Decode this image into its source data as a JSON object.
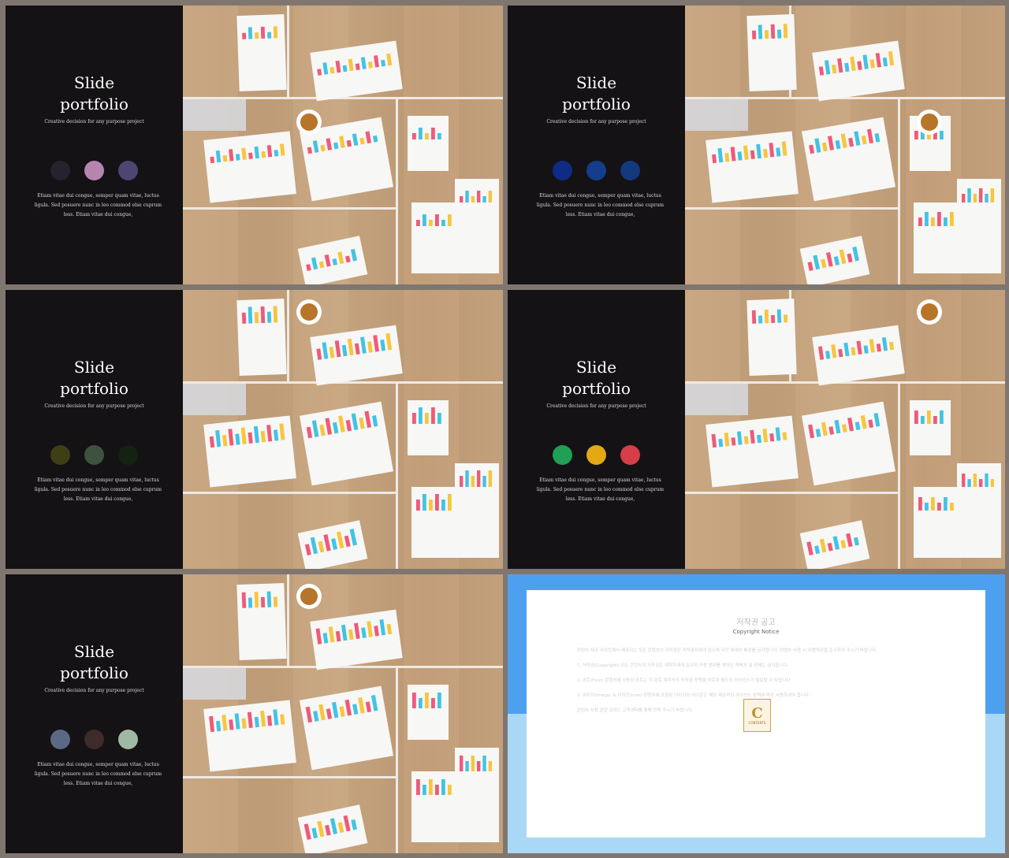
{
  "slides": [
    {
      "title": "Slide\nportfolio",
      "subtitle": "Creative decision for any purpose  project",
      "swatches": [
        "#26232f",
        "#b784b0",
        "#4d4572"
      ],
      "body": "Etiam vitae dui congue, semper  quam vitae, luctus ligula. Sed posuere nunc in leo commod else cuprum less. Etiam vitae dui congue,"
    },
    {
      "title": "Slide\nportfolio",
      "subtitle": "Creative decision for any purpose  project",
      "swatches": [
        "#0d2b87",
        "#143d8e",
        "#123a7c"
      ],
      "body": "Etiam vitae dui congue, semper  quam vitae, luctus ligula. Sed posuere nunc in leo commod else cuprum less. Etiam vitae dui congue,"
    },
    {
      "title": "Slide\nportfolio",
      "subtitle": "Creative decision for any purpose  project",
      "swatches": [
        "#3f3f16",
        "#3e523d",
        "#12230f"
      ],
      "body": "Etiam vitae dui congue, semper  quam vitae, luctus ligula. Sed posuere nunc in leo commod else cuprum less. Etiam vitae dui congue,"
    },
    {
      "title": "Slide\nportfolio",
      "subtitle": "Creative decision for any purpose  project",
      "swatches": [
        "#1fa055",
        "#e4a815",
        "#d63e4a"
      ],
      "body": "Etiam vitae dui congue, semper  quam vitae, luctus ligula. Sed posuere nunc in leo commod else cuprum less. Etiam vitae dui congue,"
    },
    {
      "title": "Slide\nportfolio",
      "subtitle": "Creative decision for any purpose  project",
      "swatches": [
        "#5a6a85",
        "#3e2b2a",
        "#9fb9a5"
      ],
      "body": "Etiam vitae dui congue, semper  quam vitae, luctus ligula. Sed posuere nunc in leo commod else cuprum less. Etiam vitae dui congue,"
    }
  ],
  "notice": {
    "title_ko": "저작권 공고",
    "title_en": "Copyright Notice",
    "logo_letter": "C",
    "logo_text": "CONTENTS",
    "paragraphs": [
      "컨텐츠 제공 사이트에서 제공되는 모든 콘텐츠의 저작권은 저작권자에게 있으며 무단 복제와 배포를 금지합니다. 컨텐츠 사용 시 이용약관을 준수하여 주시기 바랍니다.",
      "1. 저작권(Copyright) 모든 콘텐츠의 저작권은 제작자에게 있으며 사용 범위를 벗어난 재배포 및 판매는 금지됩니다.",
      "2. 폰트(Font) 콘텐츠에 사용된 폰트는 각 폰트 제작사의 저작권 정책을 따르며 별도의 라이선스가 필요할 수 있습니다.",
      "3. 이미지(Image) & 아이콘(Icon) 콘텐츠에 포함된 이미지와 아이콘은 해당 제공처의 라이선스 정책에 따라 사용하셔야 합니다.",
      "콘텐츠 사용 관련 문의는 고객센터를 통해 연락 주시기 바랍니다."
    ]
  }
}
